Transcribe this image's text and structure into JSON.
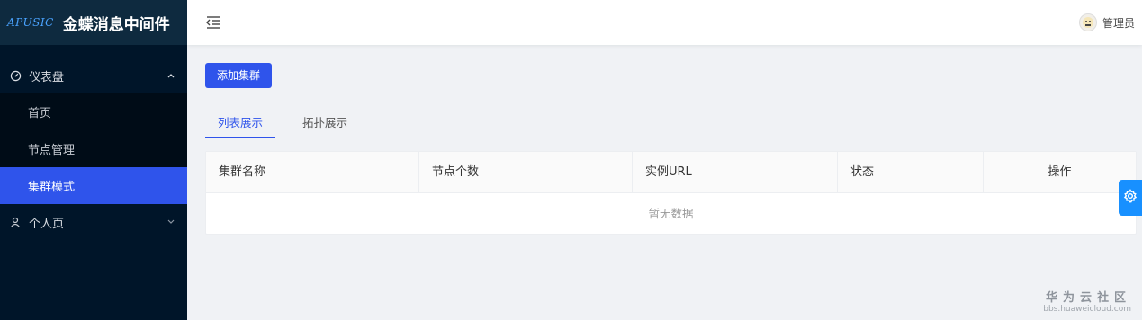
{
  "brand": {
    "logo": "APUSIC",
    "title": "金蝶消息中间件"
  },
  "sidebar": {
    "dashboard": {
      "icon": "dashboard-icon",
      "label": "仪表盘",
      "expanded": true
    },
    "items": [
      {
        "label": "首页"
      },
      {
        "label": "节点管理"
      },
      {
        "label": "集群模式",
        "active": true
      }
    ],
    "personal": {
      "icon": "user-icon",
      "label": "个人页",
      "expanded": false
    }
  },
  "header": {
    "fold_icon": "menu-fold-icon",
    "user_name": "管理员"
  },
  "main": {
    "add_button": "添加集群",
    "tabs": [
      {
        "label": "列表展示",
        "active": true
      },
      {
        "label": "拓扑展示"
      }
    ],
    "table": {
      "columns": [
        "集群名称",
        "节点个数",
        "实例URL",
        "状态",
        "操作"
      ],
      "empty_text": "暂无数据"
    }
  },
  "settings_icon": "gear-icon",
  "watermark": {
    "title": "华为云社区",
    "url": "bbs.huaweicloud.com"
  },
  "colors": {
    "sidebar_bg": "#001529",
    "primary": "#2f54eb",
    "settings_btn": "#1890ff"
  }
}
